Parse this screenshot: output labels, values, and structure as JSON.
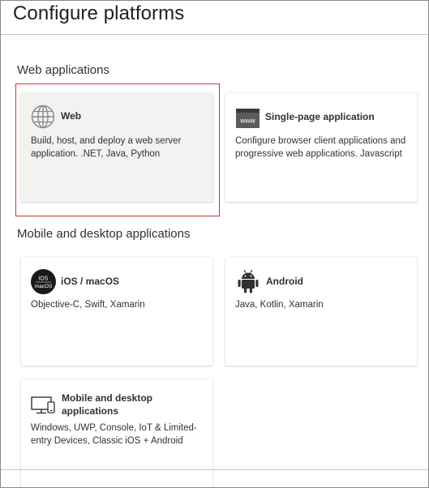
{
  "panel": {
    "title": "Configure platforms"
  },
  "sections": [
    {
      "heading": "Web applications"
    },
    {
      "heading": "Mobile and desktop applications"
    }
  ],
  "platforms": {
    "web": {
      "title": "Web",
      "description": "Build, host, and deploy a web server application. .NET, Java, Python",
      "icon": "globe-icon",
      "selected": true
    },
    "spa": {
      "title": "Single-page application",
      "description": "Configure browser client applications and progressive web applications. Javascript",
      "icon": "www-browser-icon",
      "icon_label": "www"
    },
    "ios": {
      "title": "iOS / macOS",
      "description": "Objective-C, Swift, Xamarin",
      "icon": "ios-macos-icon",
      "icon_line1": "iOS",
      "icon_line2": "macOS"
    },
    "android": {
      "title": "Android",
      "description": "Java, Kotlin, Xamarin",
      "icon": "android-icon"
    },
    "desktop": {
      "title": "Mobile and desktop applications",
      "description": "Windows, UWP, Console, IoT & Limited-entry Devices, Classic iOS + Android",
      "icon": "desktop-monitor-icon"
    }
  },
  "colors": {
    "selected_border": "#d13438",
    "selected_background": "#f3f2f1",
    "text": "#323130"
  }
}
